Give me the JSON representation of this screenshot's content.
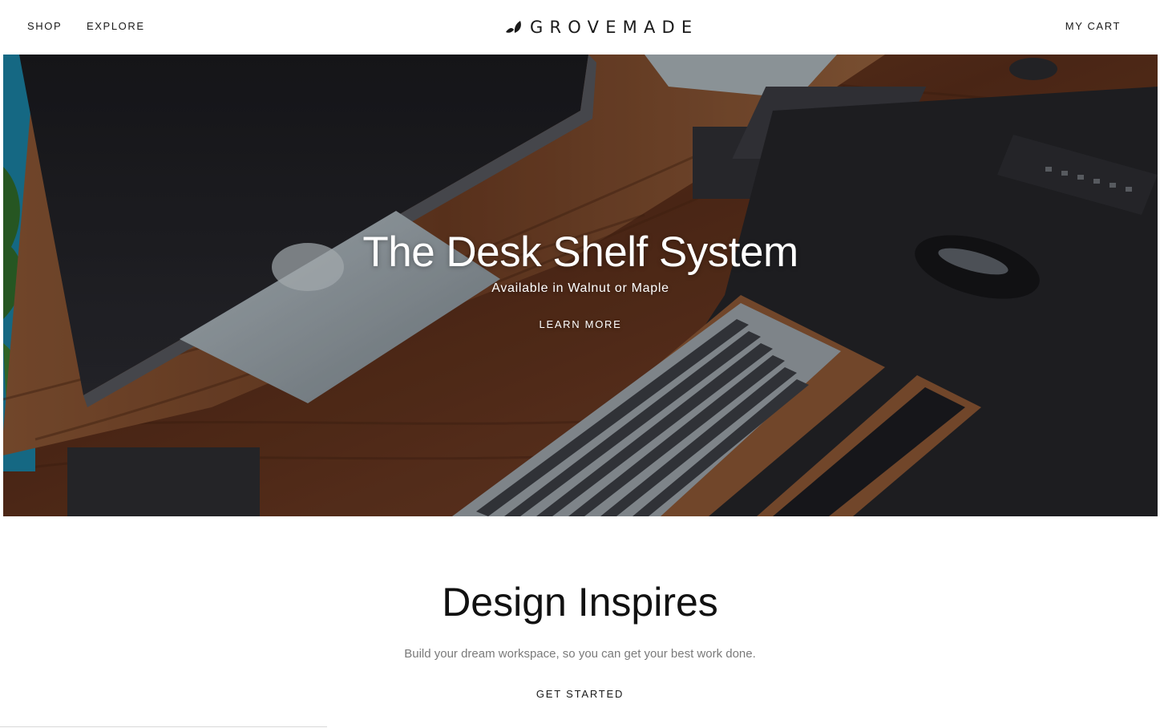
{
  "header": {
    "nav": {
      "shop": "SHOP",
      "explore": "EXPLORE"
    },
    "brand": {
      "wordmark": "GROVEMADE",
      "logo_icon": "leaf-icon"
    },
    "cart": "MY CART"
  },
  "hero": {
    "title": "The Desk Shelf System",
    "subtitle": "Available in Walnut or Maple",
    "cta": "LEARN MORE",
    "image_subject": "walnut-desk-shelf-with-monitor-keyboard-mouse"
  },
  "design_section": {
    "title": "Design Inspires",
    "subtitle": "Build your dream workspace, so you can get your best work done.",
    "cta": "GET STARTED"
  },
  "colors": {
    "text_primary": "#111111",
    "text_muted": "#7a7a7a",
    "hero_text": "#ffffff",
    "walnut": "#6b3a22"
  }
}
